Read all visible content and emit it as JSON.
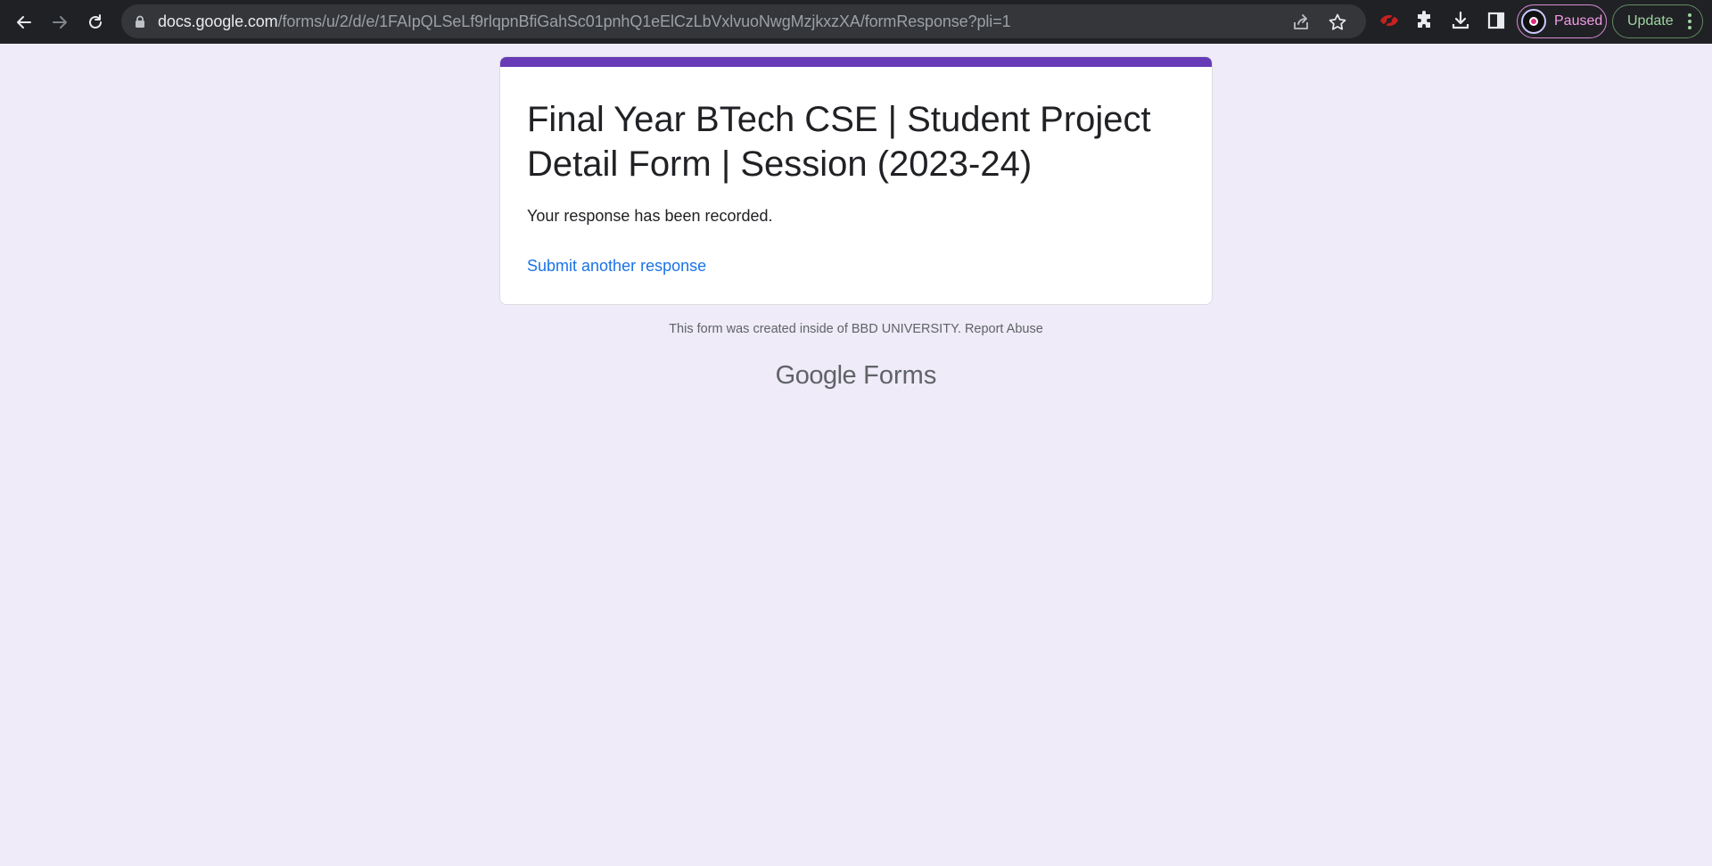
{
  "browser": {
    "url_host": "docs.google.com",
    "url_path": "/forms/u/2/d/e/1FAIpQLSeLf9rlqpnBfiGahSc01pnhQ1eElCzLbVxlvuoNwgMzjkxzXA/formResponse?pli=1",
    "profile_status": "Paused",
    "update_label": "Update",
    "icons": [
      "back-arrow-icon",
      "forward-arrow-icon",
      "reload-icon",
      "lock-icon",
      "share-icon",
      "star-icon",
      "eye-off-icon",
      "puzzle-icon",
      "download-icon",
      "side-panel-icon",
      "kebab-icon"
    ]
  },
  "form": {
    "accent_color": "#673ab7",
    "title": "Final Year BTech CSE | Student Project Detail Form | Session (2023-24)",
    "confirmation": "Your response has been recorded.",
    "submit_again": "Submit another response"
  },
  "footer": {
    "created_text": "This form was created inside of BBD UNIVERSITY.",
    "report_abuse": "Report Abuse",
    "brand_google": "Google",
    "brand_forms": "Forms"
  },
  "colors": {
    "page_background": "#efebf8",
    "link": "#1a73e8"
  }
}
